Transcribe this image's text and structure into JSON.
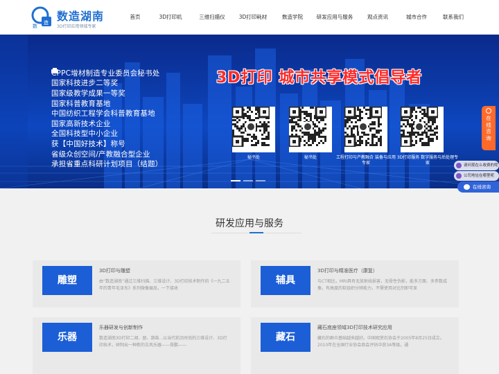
{
  "logo": {
    "title": "数造湖南",
    "sub": "3D打印应用领域专家"
  },
  "nav": [
    "首页",
    "3D打印机",
    "三维扫描仪",
    "3D打印耗材",
    "数造学院",
    "研发应用与服务",
    "观点资讯",
    "城市合作",
    "联系我们"
  ],
  "banner": {
    "honors": [
      "CPPC增材制造专业委员会秘书处",
      "国家科技进步二等奖",
      "国家级教学成果一等奖",
      "国家科普教育基地",
      "中国纺织工程学会科普教育基地",
      "国家高新技术企业",
      "全国科技型中小企业",
      "获【中国好技术】称号",
      "省级众创空间/产教融合型企业",
      "承担省重点科研计划项目（结题）"
    ],
    "slogan": "3D打印  城市共享模式倡导者",
    "qr_codes": [
      {
        "caption": "秘书处"
      },
      {
        "caption": "秘书处"
      },
      {
        "caption": "工程打印与产教融合 装备与应用专家"
      },
      {
        "caption": "3D打印服务 数字服务与后处理专家"
      }
    ]
  },
  "side": {
    "consult_tab": "在线咨询",
    "bubble1": "请问现在么收费的呢",
    "bubble2": "公司地址在哪里呢",
    "chat_button": "在线咨询"
  },
  "services": {
    "heading": "研发应用与服务",
    "cards": [
      {
        "tag": "雕塑",
        "title": "3D打印与雕塑",
        "desc": "由“数造湖南”通过三维扫描、三维设计、3D打印技术制作的《一九二五年的青年毛泽东》系列微像展品，一下接收"
      },
      {
        "tag": "辅具",
        "title": "3D打印与精准医疗（康复）",
        "desc": "与CT相比，MRI具有无放射线损害，无骨性伪影，能多方面、多参数成像，有高度的软组织分辨能力，不需使用对比剂即可显"
      },
      {
        "tag": "乐器",
        "title": "乐器研发与创新制作",
        "desc": "数造湖南3D打印二胡、琵、葫笛...以当代前沿时尚的三维设计、3D打印技术，研制出一种新的古风乐器——骨鹏——"
      },
      {
        "tag": "藏石",
        "title": "藏石底座领域3D打印技术研究应用",
        "desc": "藏石的群众基础越来越好。中国观赏石协会于2005年8月25日成立。2010年在全国行业协会商会评估中获3A等级。通"
      }
    ]
  },
  "colors": {
    "brand": "#1f6fd1",
    "card_tag": "#1c5ed6",
    "slogan": "#ff2a2a",
    "consult": "#ff6a2b"
  }
}
